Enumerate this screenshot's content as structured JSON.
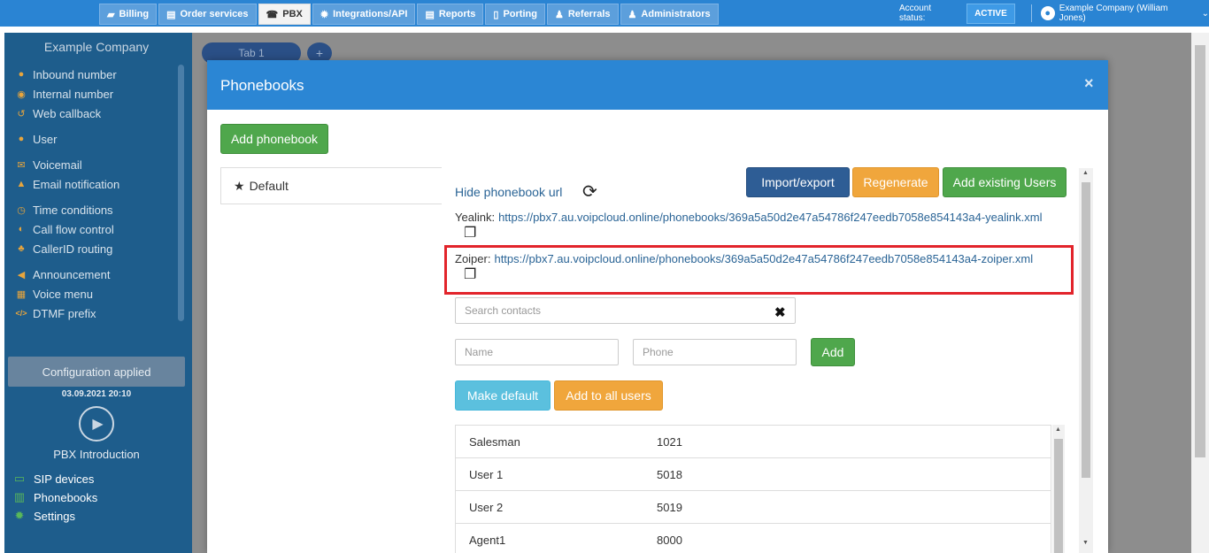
{
  "topnav": {
    "tabs": [
      {
        "label": "Billing",
        "icon": "folder-icon"
      },
      {
        "label": "Order services",
        "icon": "cart-icon"
      },
      {
        "label": "PBX",
        "icon": "phone-icon"
      },
      {
        "label": "Integrations/API",
        "icon": "gear-icon"
      },
      {
        "label": "Reports",
        "icon": "report-icon"
      },
      {
        "label": "Porting",
        "icon": "mobile-icon"
      },
      {
        "label": "Referrals",
        "icon": "person-icon"
      },
      {
        "label": "Administrators",
        "icon": "admin-icon"
      }
    ],
    "active": "PBX",
    "account_status_label": "Account status:",
    "account_status": "ACTIVE",
    "user": "Example Company (William Jones)"
  },
  "sidebar": {
    "company": "Example Company",
    "items": [
      {
        "label": "Inbound number",
        "icon": "globe-icon",
        "glyph": "●"
      },
      {
        "label": "Internal number",
        "icon": "pin-icon",
        "glyph": "◉"
      },
      {
        "label": "Web callback",
        "icon": "callback-icon",
        "glyph": "↺"
      },
      {
        "label": "User",
        "icon": "user-icon",
        "glyph": "●"
      },
      {
        "label": "Voicemail",
        "icon": "envelope-icon",
        "glyph": "✉"
      },
      {
        "label": "Email notification",
        "icon": "bell-icon",
        "glyph": "▲"
      },
      {
        "label": "Time conditions",
        "icon": "clock-icon",
        "glyph": "◷"
      },
      {
        "label": "Call flow control",
        "icon": "toggle-icon",
        "glyph": "◐"
      },
      {
        "label": "CallerID routing",
        "icon": "sitemap-icon",
        "glyph": "♣"
      },
      {
        "label": "Announcement",
        "icon": "megaphone-icon",
        "glyph": "◀"
      },
      {
        "label": "Voice menu",
        "icon": "grid-icon",
        "glyph": "▦"
      },
      {
        "label": "DTMF prefix",
        "icon": "code-icon",
        "glyph": "</>"
      }
    ],
    "config_status": "Configuration applied",
    "config_date": "03.09.2021 20:10",
    "intro": "PBX Introduction",
    "sub_items": [
      {
        "label": "SIP devices",
        "icon": "monitor-icon",
        "glyph": "▭"
      },
      {
        "label": "Phonebooks",
        "icon": "book-icon",
        "glyph": "▥"
      },
      {
        "label": "Settings",
        "icon": "gear-icon",
        "glyph": "✹"
      }
    ]
  },
  "workspace": {
    "tab_label": "Tab 1",
    "add_tab": "+"
  },
  "modal": {
    "title": "Phonebooks",
    "close": "×",
    "add_phonebook": "Add phonebook",
    "phonebooks": [
      {
        "label": "Default",
        "icon": "star-icon"
      }
    ],
    "hide_url": "Hide phonebook url",
    "import_export": "Import/export",
    "regenerate": "Regenerate",
    "add_existing_users": "Add existing Users",
    "yealink_label": "Yealink:",
    "yealink_url": "https://pbx7.au.voipcloud.online/phonebooks/369a5a50d2e47a54786f247eedb7058e854143a4-yealink.xml",
    "zoiper_label": "Zoiper:",
    "zoiper_url": "https://pbx7.au.voipcloud.online/phonebooks/369a5a50d2e47a54786f247eedb7058e854143a4-zoiper.xml",
    "search_placeholder": "Search contacts",
    "name_placeholder": "Name",
    "phone_placeholder": "Phone",
    "add": "Add",
    "make_default": "Make default",
    "add_to_all_users": "Add to all users",
    "contacts": [
      {
        "name": "Salesman",
        "phone": "1021"
      },
      {
        "name": "User 1",
        "phone": "5018"
      },
      {
        "name": "User 2",
        "phone": "5019"
      },
      {
        "name": "Agent1",
        "phone": "8000"
      }
    ]
  },
  "colors": {
    "topbar": "#2a84d3",
    "sidebar": "#1e5d8c",
    "modal_header": "#2b86d4",
    "highlight": "#e2242b"
  }
}
